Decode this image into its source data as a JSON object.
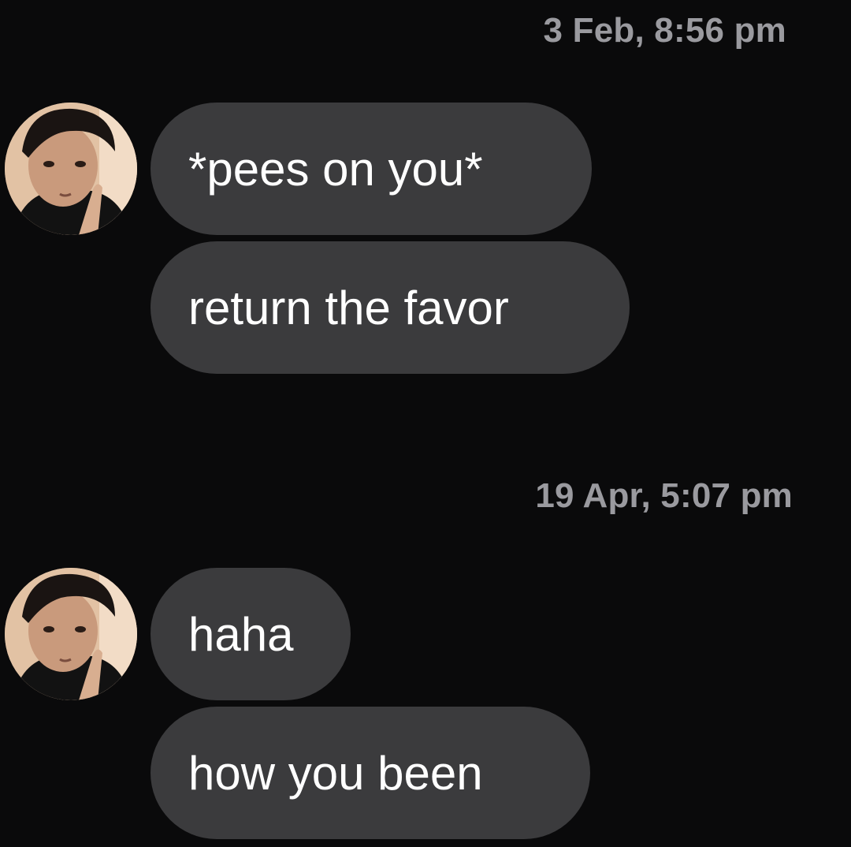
{
  "conversation": {
    "groups": [
      {
        "timestamp": "3 Feb, 8:56 pm",
        "avatar_icon": "profile-photo",
        "messages": [
          "*pees on you*",
          "return the favor"
        ]
      },
      {
        "timestamp": "19 Apr, 5:07 pm",
        "avatar_icon": "profile-photo",
        "messages": [
          "haha",
          "how you been"
        ]
      }
    ]
  },
  "colors": {
    "background": "#0a0a0b",
    "bubble": "#3b3b3d",
    "timestamp_text": "#9a9a9f",
    "message_text": "#ffffff"
  }
}
